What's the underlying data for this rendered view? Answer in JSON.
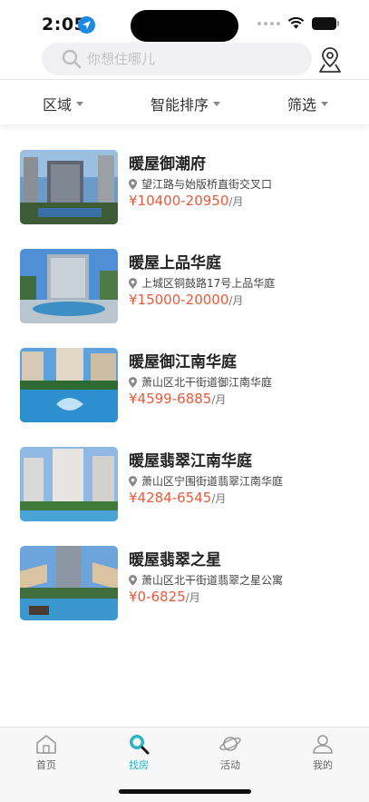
{
  "status": {
    "time": "2:05"
  },
  "search": {
    "placeholder": "你想住哪儿"
  },
  "filters": [
    {
      "label": "区域"
    },
    {
      "label": "智能排序"
    },
    {
      "label": "筛选"
    }
  ],
  "listings": [
    {
      "title": "暖屋御潮府",
      "address": "望江路与始版桥直街交叉口",
      "price": "¥10400-20950",
      "unit": "/月"
    },
    {
      "title": "暖屋上品华庭",
      "address": "上城区铜鼓路17号上品华庭",
      "price": "¥15000-20000",
      "unit": "/月"
    },
    {
      "title": "暖屋御江南华庭",
      "address": "萧山区北干街道御江南华庭",
      "price": "¥4599-6885",
      "unit": "/月"
    },
    {
      "title": "暖屋翡翠江南华庭",
      "address": "萧山区宁围街道翡翠江南华庭",
      "price": "¥4284-6545",
      "unit": "/月"
    },
    {
      "title": "暖屋翡翠之星",
      "address": "萧山区北干街道翡翠之星公寓",
      "price": "¥0-6825",
      "unit": "/月"
    }
  ],
  "tabs": [
    {
      "label": "首页",
      "icon": "home-icon"
    },
    {
      "label": "找房",
      "icon": "find-house-icon",
      "active": true
    },
    {
      "label": "活动",
      "icon": "activity-planet-icon"
    },
    {
      "label": "我的",
      "icon": "profile-icon"
    }
  ],
  "colors": {
    "accent": "#2bb3c7",
    "price": "#e85a3a"
  }
}
